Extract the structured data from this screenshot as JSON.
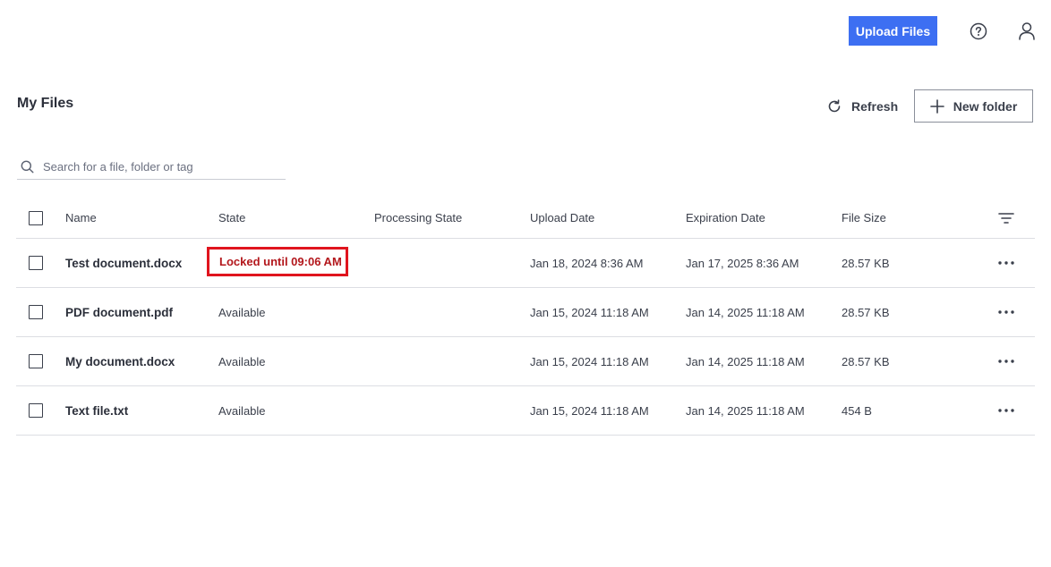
{
  "topbar": {
    "upload_label": "Upload Files",
    "help_icon": "help-circle-icon",
    "user_icon": "user-icon",
    "accent": "#3d6ff2"
  },
  "header": {
    "title": "My Files",
    "refresh_label": "Refresh",
    "new_folder_label": "New folder"
  },
  "search": {
    "placeholder": "Search for a file, folder or tag"
  },
  "table": {
    "columns": {
      "name": "Name",
      "state": "State",
      "processing_state": "Processing State",
      "upload_date": "Upload Date",
      "expiration_date": "Expiration Date",
      "file_size": "File Size"
    },
    "rows": [
      {
        "name": "Test document.docx",
        "state": "Locked until 09:06 AM",
        "processing_state": "",
        "upload_date": "Jan 18, 2024 8:36 AM",
        "expiration_date": "Jan 17, 2025 8:36 AM",
        "file_size": "28.57 KB"
      },
      {
        "name": "PDF document.pdf",
        "state": "Available",
        "processing_state": "",
        "upload_date": "Jan 15, 2024 11:18 AM",
        "expiration_date": "Jan 14, 2025 11:18 AM",
        "file_size": "28.57 KB"
      },
      {
        "name": "My document.docx",
        "state": "Available",
        "processing_state": "",
        "upload_date": "Jan 15, 2024 11:18 AM",
        "expiration_date": "Jan 14, 2025 11:18 AM",
        "file_size": "28.57 KB"
      },
      {
        "name": "Text file.txt",
        "state": "Available",
        "processing_state": "",
        "upload_date": "Jan 15, 2024 11:18 AM",
        "expiration_date": "Jan 14, 2025 11:18 AM",
        "file_size": "454 B"
      }
    ]
  },
  "colors": {
    "locked_text": "#b3171c",
    "highlight_border": "#e0141e"
  }
}
